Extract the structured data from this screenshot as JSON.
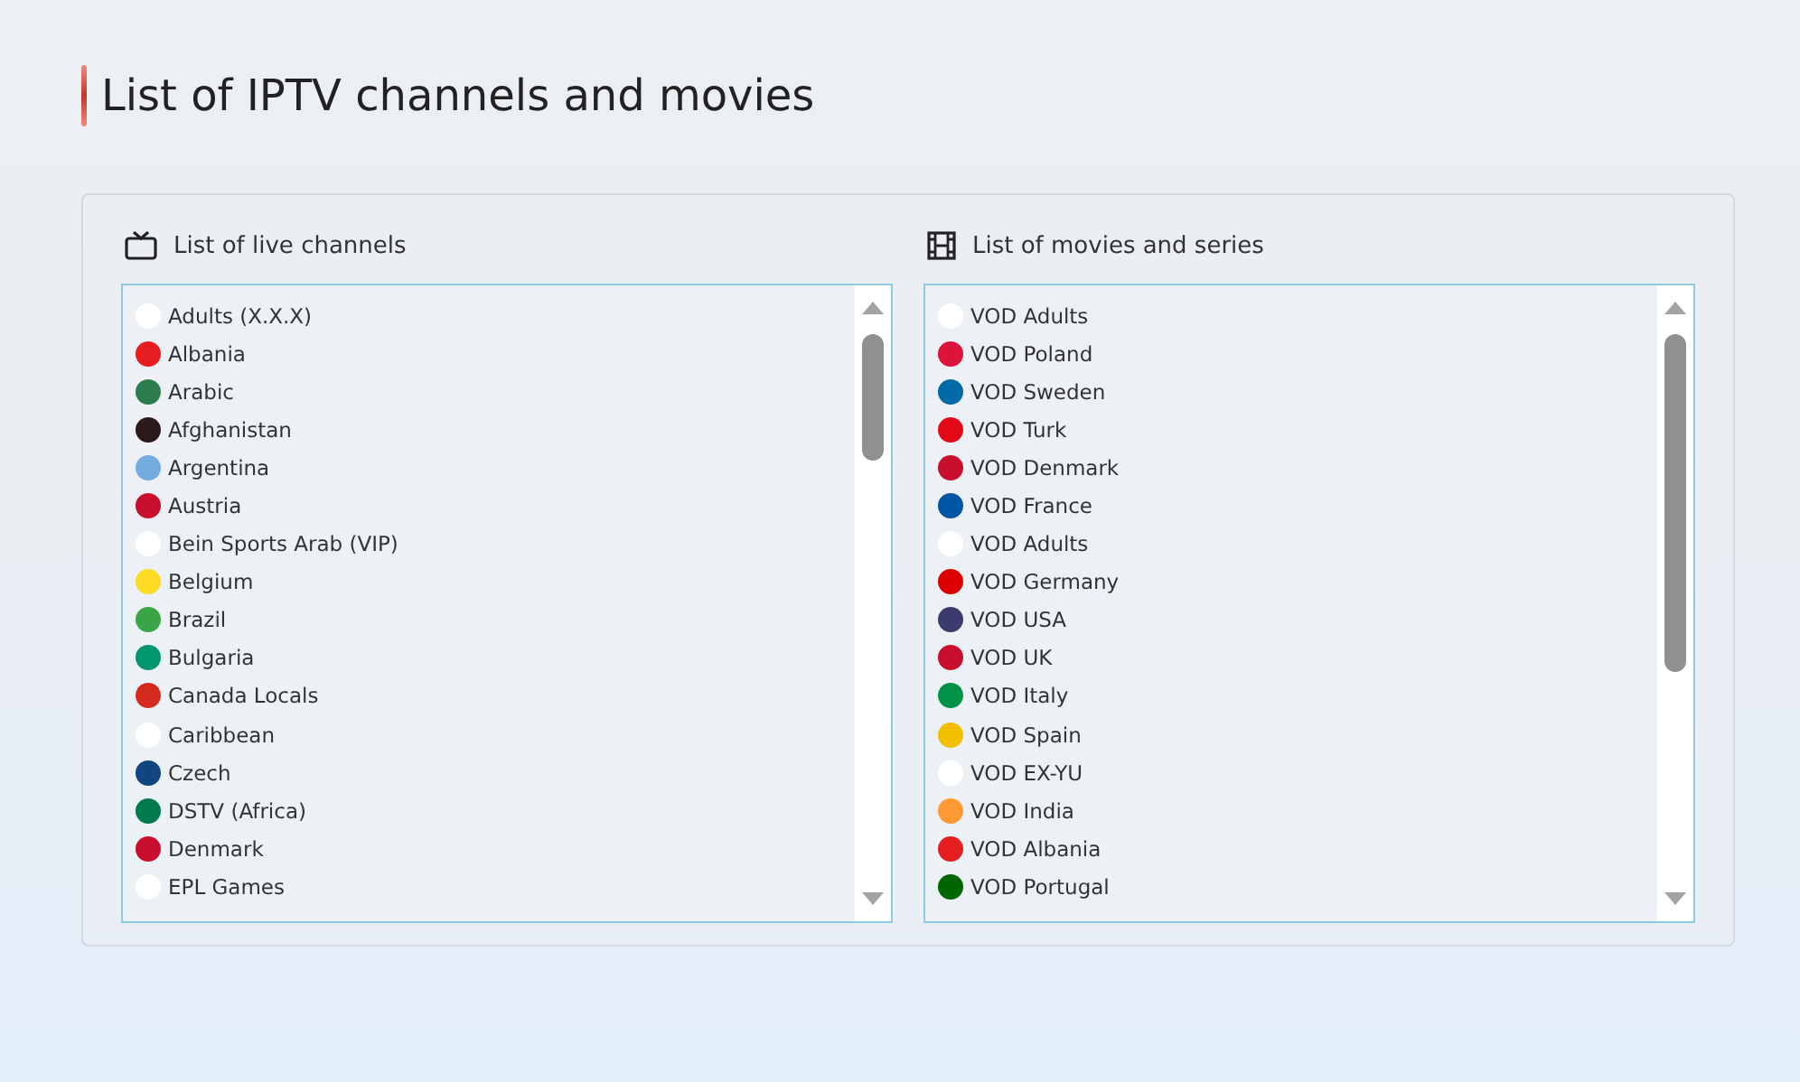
{
  "title": "List of IPTV channels and movies",
  "panels": [
    {
      "kind": "tv",
      "heading": "List of live channels",
      "items": [
        {
          "label": "Adults (X.X.X)",
          "color": "#ffffff"
        },
        {
          "label": "Albania",
          "color": "#e41e20"
        },
        {
          "label": "Arabic",
          "color": "#2e7d4f"
        },
        {
          "label": "Afghanistan",
          "color": "#2a1a1a"
        },
        {
          "label": "Argentina",
          "color": "#74acdf"
        },
        {
          "label": "Austria",
          "color": "#c8102e"
        },
        {
          "label": "Bein Sports Arab (VIP)",
          "color": "#ffffff"
        },
        {
          "label": "Belgium",
          "color": "#fdda24"
        },
        {
          "label": "Brazil",
          "color": "#3aa546"
        },
        {
          "label": "Bulgaria",
          "color": "#00966e"
        },
        {
          "label": "Canada Locals",
          "color": "#d52b1e"
        },
        {
          "label": "Caribbean",
          "color": "#ffffff"
        },
        {
          "label": "Czech",
          "color": "#11457e"
        },
        {
          "label": "DSTV (Africa)",
          "color": "#007a4d"
        },
        {
          "label": "Denmark",
          "color": "#c8102e"
        },
        {
          "label": "EPL Games",
          "color": "#ffffff"
        }
      ]
    },
    {
      "kind": "film",
      "heading": "List of movies and series",
      "items": [
        {
          "label": "VOD Adults",
          "color": "#ffffff"
        },
        {
          "label": "VOD Poland",
          "color": "#dc143c"
        },
        {
          "label": "VOD Sweden",
          "color": "#006aa7"
        },
        {
          "label": "VOD Turk",
          "color": "#e30a17"
        },
        {
          "label": "VOD Denmark",
          "color": "#c8102e"
        },
        {
          "label": "VOD France",
          "color": "#0055a4"
        },
        {
          "label": "VOD Adults",
          "color": "#ffffff"
        },
        {
          "label": "VOD Germany",
          "color": "#dd0000"
        },
        {
          "label": "VOD USA",
          "color": "#3c3b6e"
        },
        {
          "label": "VOD UK",
          "color": "#c8102e"
        },
        {
          "label": "VOD Italy",
          "color": "#009246"
        },
        {
          "label": "VOD Spain",
          "color": "#f1bf00"
        },
        {
          "label": "VOD EX-YU",
          "color": "#ffffff"
        },
        {
          "label": "VOD India",
          "color": "#ff9933"
        },
        {
          "label": "VOD Albania",
          "color": "#e41e20"
        },
        {
          "label": "VOD Portugal",
          "color": "#006600"
        }
      ]
    }
  ]
}
